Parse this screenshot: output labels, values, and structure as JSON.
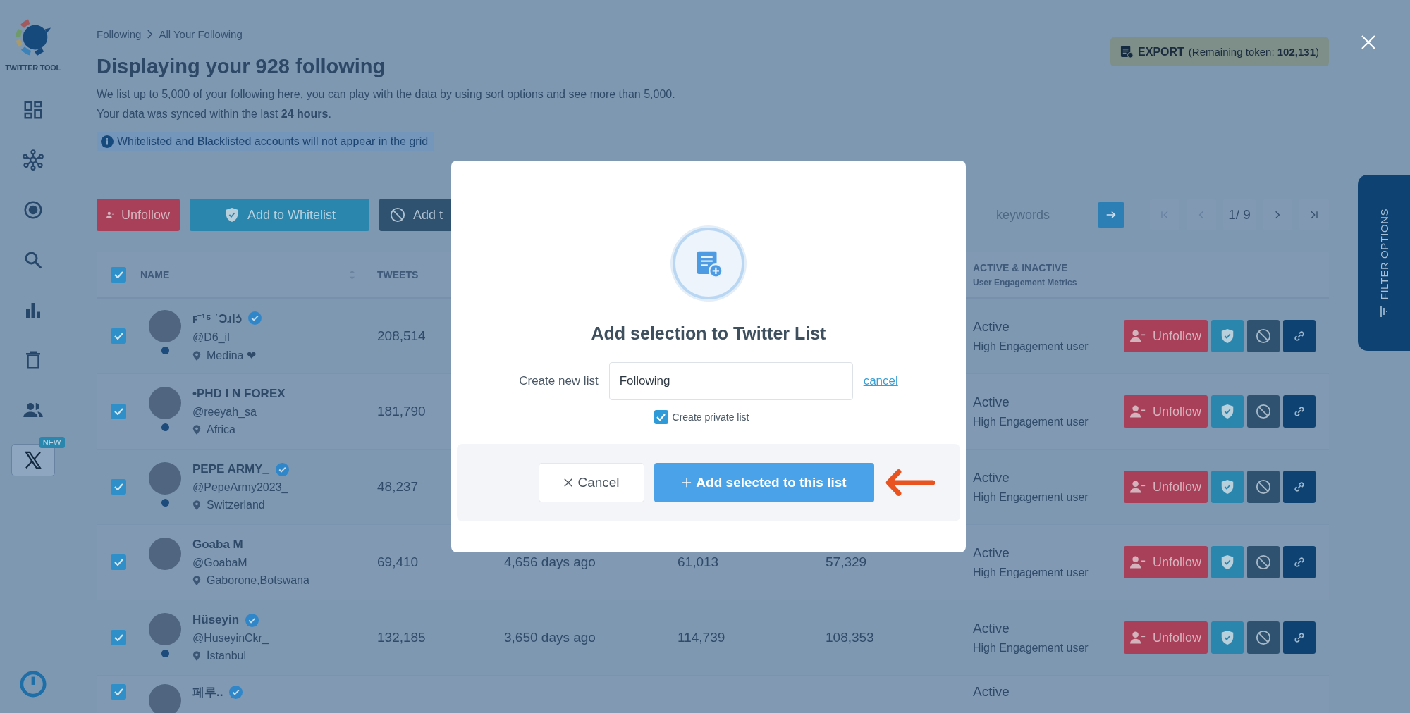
{
  "sidebar": {
    "brand": "TWITTER TOOL",
    "items": [
      {
        "kind": "dashboard",
        "selected": false
      },
      {
        "kind": "network",
        "selected": false
      },
      {
        "kind": "target",
        "selected": false
      },
      {
        "kind": "search",
        "selected": false
      },
      {
        "kind": "chart",
        "selected": false
      },
      {
        "kind": "trash",
        "selected": false
      },
      {
        "kind": "users",
        "selected": false
      },
      {
        "kind": "x",
        "selected": true,
        "badge": "NEW"
      }
    ]
  },
  "breadcrumb": [
    "Following",
    "All Your Following"
  ],
  "title": "Displaying your 928 following",
  "description": [
    "We list up to 5,000 of your following here, you can play with the data by using sort options and see more than 5,000.",
    "Your data was synced within the last **24 hours**."
  ],
  "notice": "Whitelisted and Blacklisted accounts will not appear in the grid",
  "export": {
    "label": "EXPORT",
    "note": "(Remaining token: **102,131**)"
  },
  "toolbar": [
    {
      "kind": "unfollow",
      "label": "Unfollow"
    },
    {
      "kind": "whitelist",
      "label": "Add to Whitelist"
    },
    {
      "kind": "blacklist",
      "label": "Add t"
    }
  ],
  "search": {
    "placeholder": "keywords"
  },
  "pagination": {
    "page": "1/ 9",
    "first_disabled": true,
    "prev_disabled": true,
    "next_disabled": false,
    "last_disabled": false
  },
  "filter_tab": "FILTER OPTIONS",
  "table": {
    "select_all": true,
    "columns": [
      {
        "kind": "name",
        "label": "NAME",
        "sortable": true
      },
      {
        "kind": "tweets",
        "label": "TWEETS"
      },
      {
        "kind": "status",
        "label": "ACTIVE & INACTIVE",
        "sub": "User Engagement Metrics"
      }
    ],
    "rows": [
      {
        "kind": "full",
        "checked": true,
        "name": "ꜰ⁻¹⁵ ʿƆɹlɔ̇",
        "verified": true,
        "online": true,
        "handle": "@D6_il",
        "location": "Medina ❤",
        "tweets": "208,514",
        "status": "Active",
        "engagement": "High Engagement user",
        "action": "Unfollow"
      },
      {
        "kind": "full",
        "checked": true,
        "name": "•PHD I N FOREX",
        "verified": false,
        "online": true,
        "handle": "@reeyah_sa",
        "location": "Africa",
        "tweets": "181,790",
        "status": "Active",
        "engagement": "High Engagement user",
        "action": "Unfollow"
      },
      {
        "kind": "full",
        "checked": true,
        "name": "PEPE ARMY_",
        "verified": true,
        "online": true,
        "handle": "@PepeArmy2023_",
        "location": "Switzerland",
        "tweets": "48,237",
        "status": "Active",
        "engagement": "High Engagement user",
        "action": "Unfollow"
      },
      {
        "kind": "full",
        "checked": true,
        "name": "Goaba M",
        "verified": false,
        "online": false,
        "handle": "@GoabaM",
        "location": "Gaborone,Botswana",
        "tweets": "69,410",
        "column_3": "4,656 days ago",
        "column_4": "61,013",
        "column_5": "57,329",
        "status": "Active",
        "engagement": "High Engagement user",
        "action": "Unfollow"
      },
      {
        "kind": "full",
        "checked": true,
        "name": "Hüseyin",
        "verified": true,
        "online": true,
        "handle": "@HuseyinCkr_",
        "location": "İstanbul",
        "tweets": "132,185",
        "column_3": "3,650 days ago",
        "column_4": "114,739",
        "column_5": "108,353",
        "status": "Active",
        "engagement": "High Engagement user",
        "action": "Unfollow"
      },
      {
        "kind": "partial",
        "checked": true,
        "name": "페루..",
        "verified": true,
        "online": false,
        "status": "Active"
      }
    ]
  },
  "modal": {
    "title": "Add selection to Twitter List",
    "field_label": "Create new list",
    "value": "Following",
    "cancel_link": "cancel",
    "private": {
      "label": "Create private list",
      "checked": true
    },
    "buttons": [
      {
        "kind": "secondary",
        "label": "Cancel"
      },
      {
        "kind": "primary",
        "label": "Add selected to this list"
      }
    ]
  }
}
